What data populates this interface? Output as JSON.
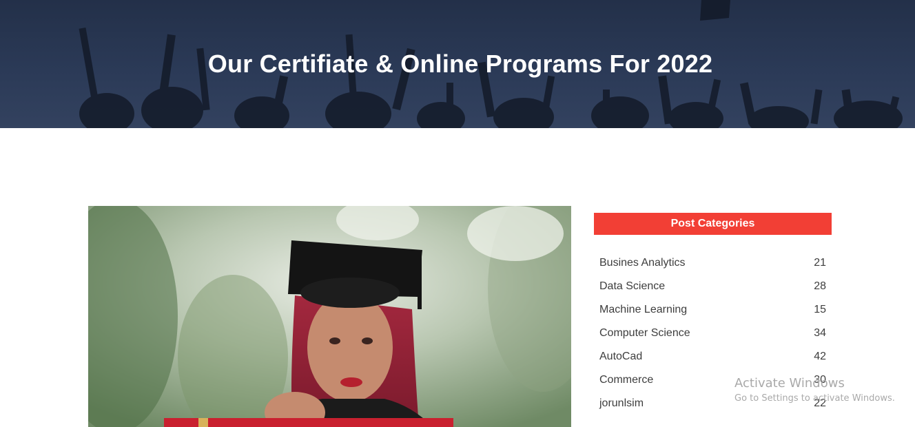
{
  "hero": {
    "title": "Our Certifiate & Online Programs For 2022"
  },
  "sidebar": {
    "header": "Post Categories",
    "categories": [
      {
        "name": "Busines Analytics",
        "count": "21"
      },
      {
        "name": "Data Science",
        "count": "28"
      },
      {
        "name": "Machine Learning",
        "count": "15"
      },
      {
        "name": "Computer Science",
        "count": "34"
      },
      {
        "name": "AutoCad",
        "count": "42"
      },
      {
        "name": "Commerce",
        "count": "30"
      },
      {
        "name": "jorunlsim",
        "count": "22"
      }
    ]
  },
  "watermark": {
    "title": "Activate Windows",
    "subtitle": "Go to Settings to activate Windows."
  },
  "colors": {
    "hero_overlay": "#233049",
    "category_header": "#f23f35",
    "text": "#3d3d3d"
  }
}
